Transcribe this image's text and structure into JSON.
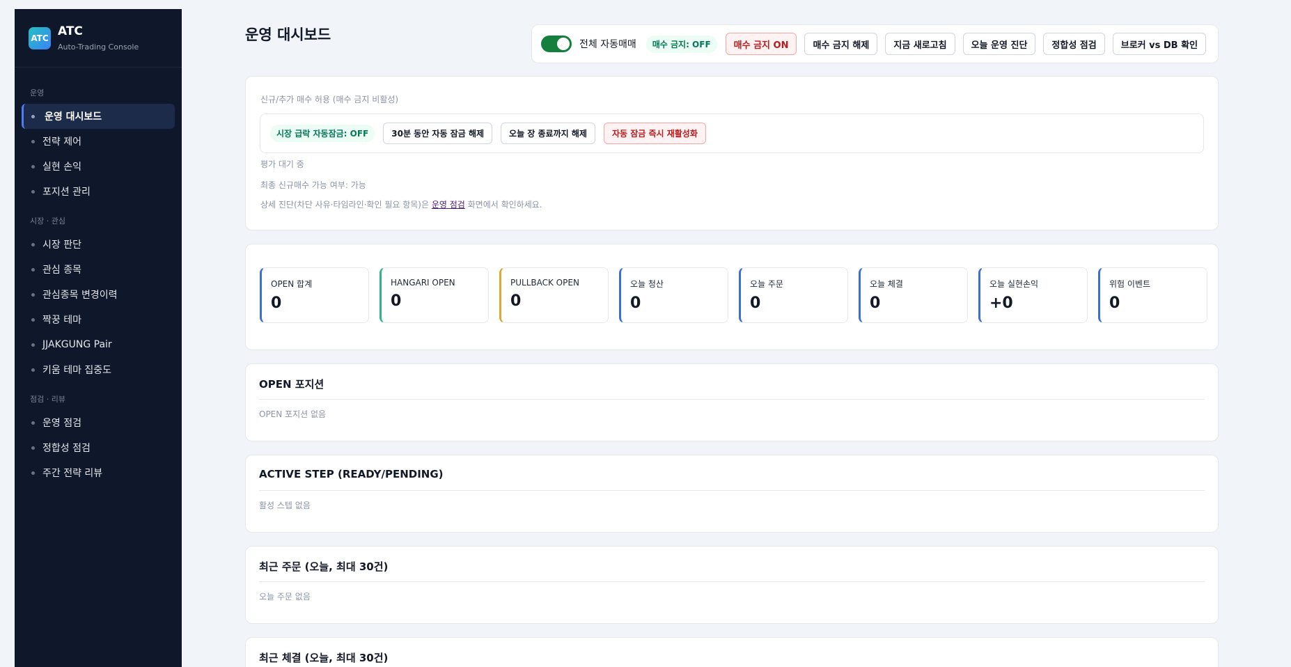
{
  "brand": {
    "logo": "ATC",
    "title": "ATC",
    "subtitle": "Auto-Trading Console"
  },
  "sidebar": {
    "sections": [
      {
        "label": "운영",
        "items": [
          {
            "label": "운영 대시보드",
            "active": true
          },
          {
            "label": "전략 제어"
          },
          {
            "label": "실현 손익"
          },
          {
            "label": "포지션 관리"
          }
        ]
      },
      {
        "label": "시장 · 관심",
        "items": [
          {
            "label": "시장 판단"
          },
          {
            "label": "관심 종목"
          },
          {
            "label": "관심종목 변경이력"
          },
          {
            "label": "짝꿍 테마"
          },
          {
            "label": "JJAKGUNG Pair"
          },
          {
            "label": "키움 테마 집중도"
          }
        ]
      },
      {
        "label": "점검 · 리뷰",
        "items": [
          {
            "label": "운영 점검"
          },
          {
            "label": "정합성 점검"
          },
          {
            "label": "주간 전략 리뷰"
          }
        ]
      }
    ]
  },
  "page": {
    "title": "운영 대시보드"
  },
  "toolbar": {
    "auto_trading_label": "전체 자동매매",
    "auto_trading_on": true,
    "buy_block_status": "매수 금지: OFF",
    "buy_block_on": "매수 금지 ON",
    "buy_block_off": "매수 금지 해제",
    "refresh": "지금 새로고침",
    "diagnose": "오늘 운영 진단",
    "consistency": "정합성 점검",
    "broker_vs_db": "브로커 vs DB 확인"
  },
  "lock_card": {
    "label": "신규/추가 매수 허용 (매수 금지 비활성)",
    "lock_status": "시장 급락 자동잠금: OFF",
    "unlock_30": "30분 동안 자동 잠금 해제",
    "unlock_today": "오늘 장 종료까지 해제",
    "relock": "자동 잠금 즉시 재활성화",
    "eval": "평가 대기 중",
    "final": "최종 신규매수 가능 여부: 가능",
    "detail_prefix": "상세 진단(차단 사유·타임라인·확인 필요 항목)은 ",
    "detail_link": "운영 점검",
    "detail_suffix": " 화면에서 확인하세요."
  },
  "stats": [
    {
      "label": "OPEN 합계",
      "value": "0",
      "color": "#3b6fd8"
    },
    {
      "label": "HANGARI OPEN",
      "value": "0",
      "color": "#2fb487"
    },
    {
      "label": "PULLBACK OPEN",
      "value": "0",
      "color": "#e0a82e"
    },
    {
      "label": "오늘 청산",
      "value": "0",
      "color": "#3b6fd8"
    },
    {
      "label": "오늘 주문",
      "value": "0",
      "color": "#3b6fd8"
    },
    {
      "label": "오늘 체결",
      "value": "0",
      "color": "#3b6fd8"
    },
    {
      "label": "오늘 실현손익",
      "value": "+0",
      "color": "#3b6fd8"
    },
    {
      "label": "위험 이벤트",
      "value": "0",
      "color": "#3b6fd8"
    }
  ],
  "sections": {
    "open_positions": {
      "title": "OPEN 포지션",
      "empty": "OPEN 포지션 없음"
    },
    "active_step": {
      "title": "ACTIVE STEP (READY/PENDING)",
      "empty": "활성 스텝 없음"
    },
    "recent_orders": {
      "title": "최근 주문 (오늘, 최대 30건)",
      "empty": "오늘 주문 없음"
    },
    "recent_fills": {
      "title": "최근 체결 (오늘, 최대 30건)"
    }
  }
}
